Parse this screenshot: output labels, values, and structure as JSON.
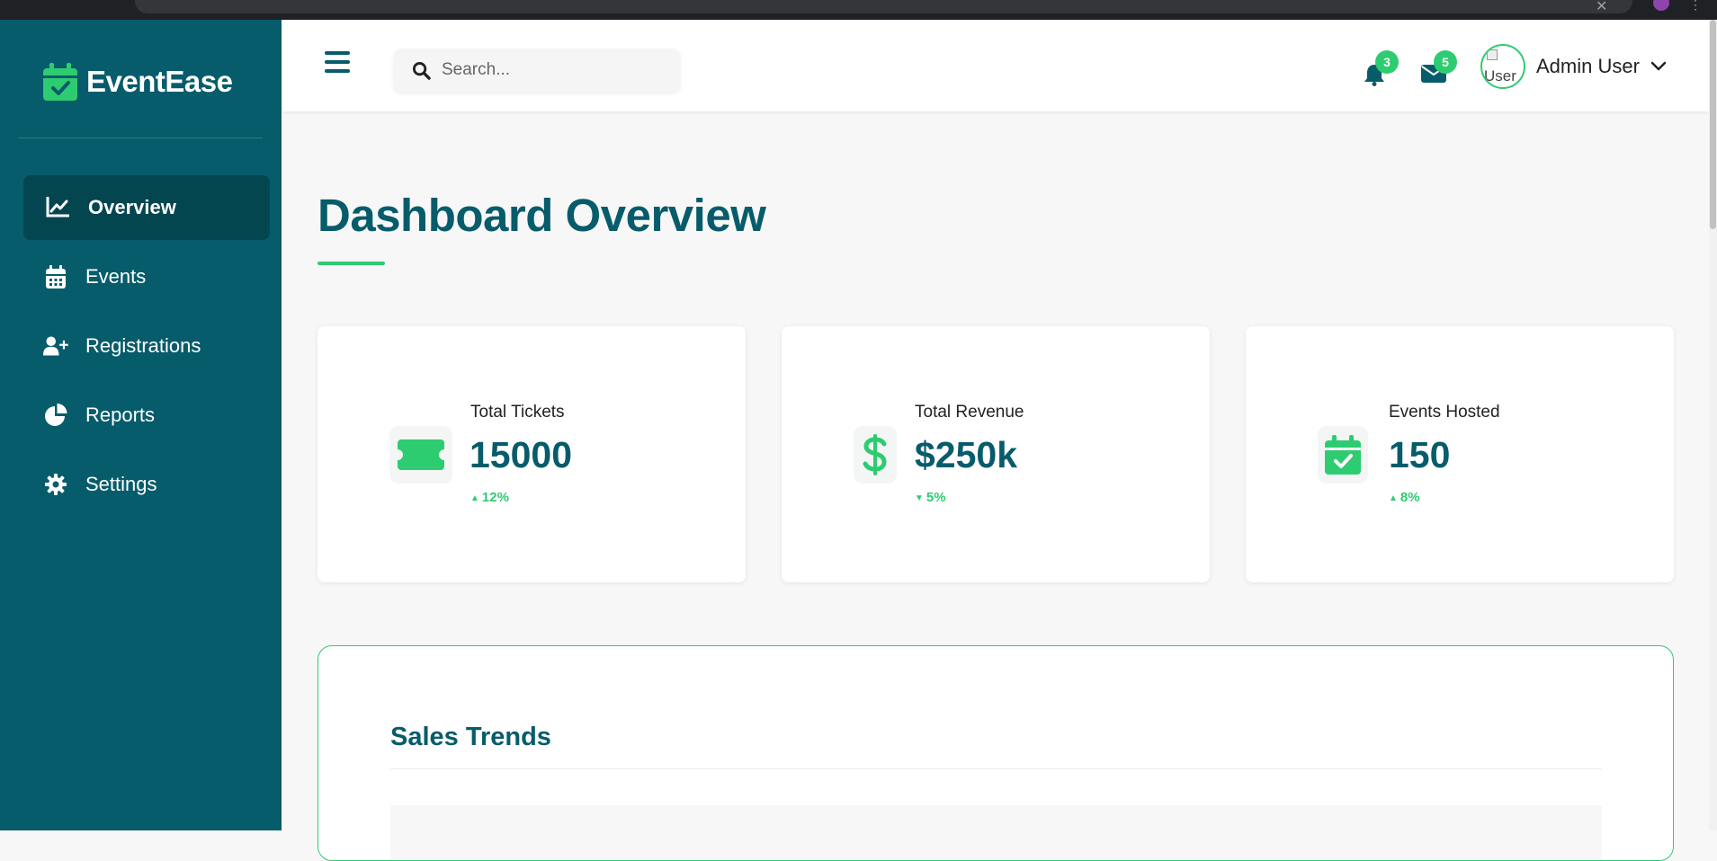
{
  "app": {
    "name": "EventEase"
  },
  "sidebar": {
    "items": [
      {
        "label": "Overview",
        "icon": "chart-line-icon",
        "active": true
      },
      {
        "label": "Events",
        "icon": "calendar-icon",
        "active": false
      },
      {
        "label": "Registrations",
        "icon": "user-plus-icon",
        "active": false
      },
      {
        "label": "Reports",
        "icon": "pie-chart-icon",
        "active": false
      },
      {
        "label": "Settings",
        "icon": "gear-icon",
        "active": false
      }
    ]
  },
  "header": {
    "search_placeholder": "Search...",
    "notifications_count": "3",
    "messages_count": "5",
    "avatar_alt": "User",
    "user_name": "Admin User"
  },
  "main": {
    "title": "Dashboard Overview",
    "stats": [
      {
        "label": "Total Tickets",
        "value": "15000",
        "trend": "12%",
        "direction": "up",
        "icon": "ticket-icon"
      },
      {
        "label": "Total Revenue",
        "value": "$250k",
        "trend": "5%",
        "direction": "down",
        "icon": "dollar-icon"
      },
      {
        "label": "Events Hosted",
        "value": "150",
        "trend": "8%",
        "direction": "up",
        "icon": "calendar-check-icon"
      }
    ],
    "sales_title": "Sales Trends"
  },
  "colors": {
    "primary": "#075c6b",
    "sidebar_active": "#04464f",
    "accent": "#2ecc71",
    "background": "#f7f7f7"
  }
}
